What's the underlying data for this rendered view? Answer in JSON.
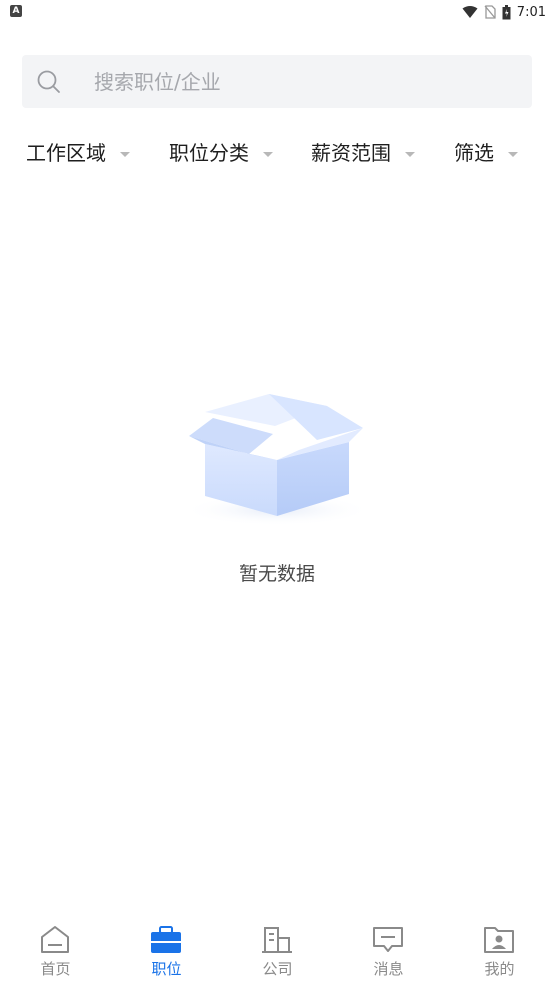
{
  "status_bar": {
    "left_badge": "A",
    "time": "7:01",
    "icons": [
      "wifi-icon",
      "no-sim-icon",
      "battery-icon"
    ]
  },
  "search": {
    "placeholder": "搜索职位/企业",
    "icon": "search-icon"
  },
  "filters": [
    {
      "label": "工作区域"
    },
    {
      "label": "职位分类"
    },
    {
      "label": "薪资范围"
    },
    {
      "label": "筛选"
    }
  ],
  "empty_state": {
    "message": "暂无数据",
    "icon": "empty-box-icon"
  },
  "tabbar": {
    "active_color": "#1a73e8",
    "inactive_color": "#8a8a8a",
    "items": [
      {
        "label": "首页",
        "icon": "home-icon",
        "active": false
      },
      {
        "label": "职位",
        "icon": "briefcase-icon",
        "active": true
      },
      {
        "label": "公司",
        "icon": "building-icon",
        "active": false
      },
      {
        "label": "消息",
        "icon": "message-icon",
        "active": false
      },
      {
        "label": "我的",
        "icon": "profile-icon",
        "active": false
      }
    ]
  }
}
